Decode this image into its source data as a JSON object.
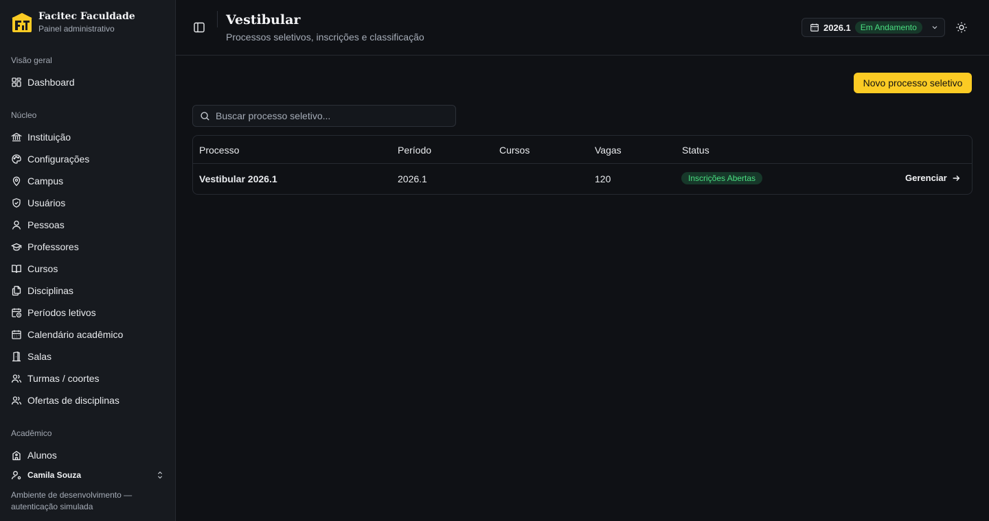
{
  "brand": {
    "name": "Facitec Faculdade",
    "subtitle": "Painel administrativo",
    "accent": "#fbcb24"
  },
  "sidebar": {
    "sections": [
      {
        "label": "Visão geral",
        "items": [
          {
            "label": "Dashboard",
            "icon": "dashboard-icon"
          }
        ]
      },
      {
        "label": "Núcleo",
        "items": [
          {
            "label": "Instituição",
            "icon": "landmark-icon"
          },
          {
            "label": "Configurações",
            "icon": "palette-icon"
          },
          {
            "label": "Campus",
            "icon": "map-pin-icon"
          },
          {
            "label": "Usuários",
            "icon": "shield-icon"
          },
          {
            "label": "Pessoas",
            "icon": "user-icon"
          },
          {
            "label": "Professores",
            "icon": "graduation-cap-icon"
          },
          {
            "label": "Cursos",
            "icon": "book-open-icon"
          },
          {
            "label": "Disciplinas",
            "icon": "files-icon"
          },
          {
            "label": "Períodos letivos",
            "icon": "calendar-clock-icon"
          },
          {
            "label": "Calendário acadêmico",
            "icon": "calendar-icon"
          },
          {
            "label": "Salas",
            "icon": "door-icon"
          },
          {
            "label": "Turmas / coortes",
            "icon": "users-icon"
          },
          {
            "label": "Ofertas de disciplinas",
            "icon": "users-icon"
          }
        ]
      },
      {
        "label": "Acadêmico",
        "items": [
          {
            "label": "Alunos",
            "icon": "school-icon"
          }
        ]
      }
    ],
    "user": {
      "name": "Camila Souza"
    },
    "env_note": "Ambiente de desenvolvimento — autenticação simulada"
  },
  "header": {
    "title": "Vestibular",
    "subtitle": "Processos seletivos, inscrições e classificação",
    "period": {
      "value": "2026.1",
      "status": "Em Andamento"
    }
  },
  "main": {
    "new_button": "Novo processo seletivo",
    "search": {
      "placeholder": "Buscar processo seletivo...",
      "value": ""
    },
    "table": {
      "columns": [
        "Processo",
        "Período",
        "Cursos",
        "Vagas",
        "Status"
      ],
      "rows": [
        {
          "processo": "Vestibular 2026.1",
          "periodo": "2026.1",
          "cursos": "",
          "vagas": "120",
          "status": "Inscrições Abertas",
          "action": "Gerenciar"
        }
      ]
    }
  },
  "colors": {
    "background": "#0f1115",
    "sidebar": "#171a1f",
    "success": "#4ade80",
    "success_bg": "#17382a"
  }
}
